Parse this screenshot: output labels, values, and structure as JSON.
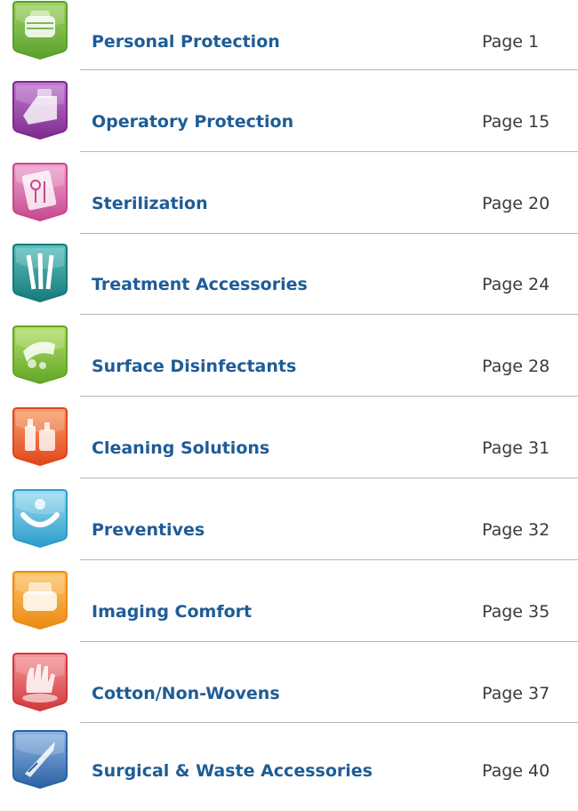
{
  "toc": {
    "entries": [
      {
        "label": "Personal Protection",
        "page": "Page 1",
        "icon": "face-mask-icon",
        "color": "#5aa02c",
        "color_light": "#9fd466"
      },
      {
        "label": "Operatory Protection",
        "page": "Page 15",
        "icon": "barrier-cover-icon",
        "color": "#7d2a8e",
        "color_light": "#c27ad0"
      },
      {
        "label": "Sterilization",
        "page": "Page 20",
        "icon": "sterilization-pouch-icon",
        "color": "#c6488f",
        "color_light": "#f0a6d0"
      },
      {
        "label": "Treatment Accessories",
        "page": "Page 24",
        "icon": "dental-instruments-icon",
        "color": "#157a7a",
        "color_light": "#5fc1c1"
      },
      {
        "label": "Surface Disinfectants",
        "page": "Page 28",
        "icon": "disinfectant-wipe-icon",
        "color": "#62a625",
        "color_light": "#b5e06a"
      },
      {
        "label": "Cleaning Solutions",
        "page": "Page 31",
        "icon": "cleaning-bottles-icon",
        "color": "#e0461c",
        "color_light": "#f8a06a"
      },
      {
        "label": "Preventives",
        "page": "Page 32",
        "icon": "smile-icon",
        "color": "#2a9dc9",
        "color_light": "#9ddcf2"
      },
      {
        "label": "Imaging Comfort",
        "page": "Page 35",
        "icon": "imaging-cushion-icon",
        "color": "#ec8a12",
        "color_light": "#fbc467"
      },
      {
        "label": "Cotton/Non-Wovens",
        "page": "Page 37",
        "icon": "hand-cotton-icon",
        "color": "#d2373a",
        "color_light": "#f59a9c"
      },
      {
        "label": "Surgical & Waste Accessories",
        "page": "Page 40",
        "icon": "scalpel-icon",
        "color": "#2a62a4",
        "color_light": "#8fb6e4"
      }
    ]
  }
}
